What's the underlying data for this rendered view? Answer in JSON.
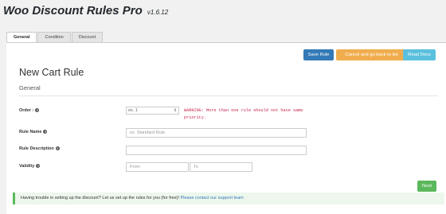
{
  "app": {
    "title": "Woo Discount Rules Pro",
    "version": "v1.6.12"
  },
  "tabs": [
    {
      "label": "General",
      "active": true
    },
    {
      "label": "Condition",
      "active": false
    },
    {
      "label": "Discount",
      "active": false
    }
  ],
  "toolbar": {
    "save_label": "Save Rule",
    "cancel_label": "Cancel and go back to list",
    "docs_label": "Read Docs"
  },
  "page": {
    "title": "New Cart Rule",
    "section": "General"
  },
  "form": {
    "order": {
      "label": "Order :",
      "placeholder": "ex. 1",
      "warning": "WARNING: More than one rule should not have same priority."
    },
    "rule_name": {
      "label": "Rule Name",
      "placeholder": "ex. Standard Rule."
    },
    "rule_description": {
      "label": "Rule Description",
      "value": ""
    },
    "validity": {
      "label": "Validity",
      "from_placeholder": "From",
      "to_placeholder": "To"
    }
  },
  "next_label": "Next",
  "notice": {
    "text": "Having trouble in setting up the discount? Let us set up the rules for you (for free)!",
    "link": "Please contact our support team"
  },
  "colors": {
    "save": "#337ab7",
    "cancel": "#f0ad4e",
    "docs": "#5bc0de",
    "next": "#5cb85c",
    "warning": "#c7254e"
  }
}
